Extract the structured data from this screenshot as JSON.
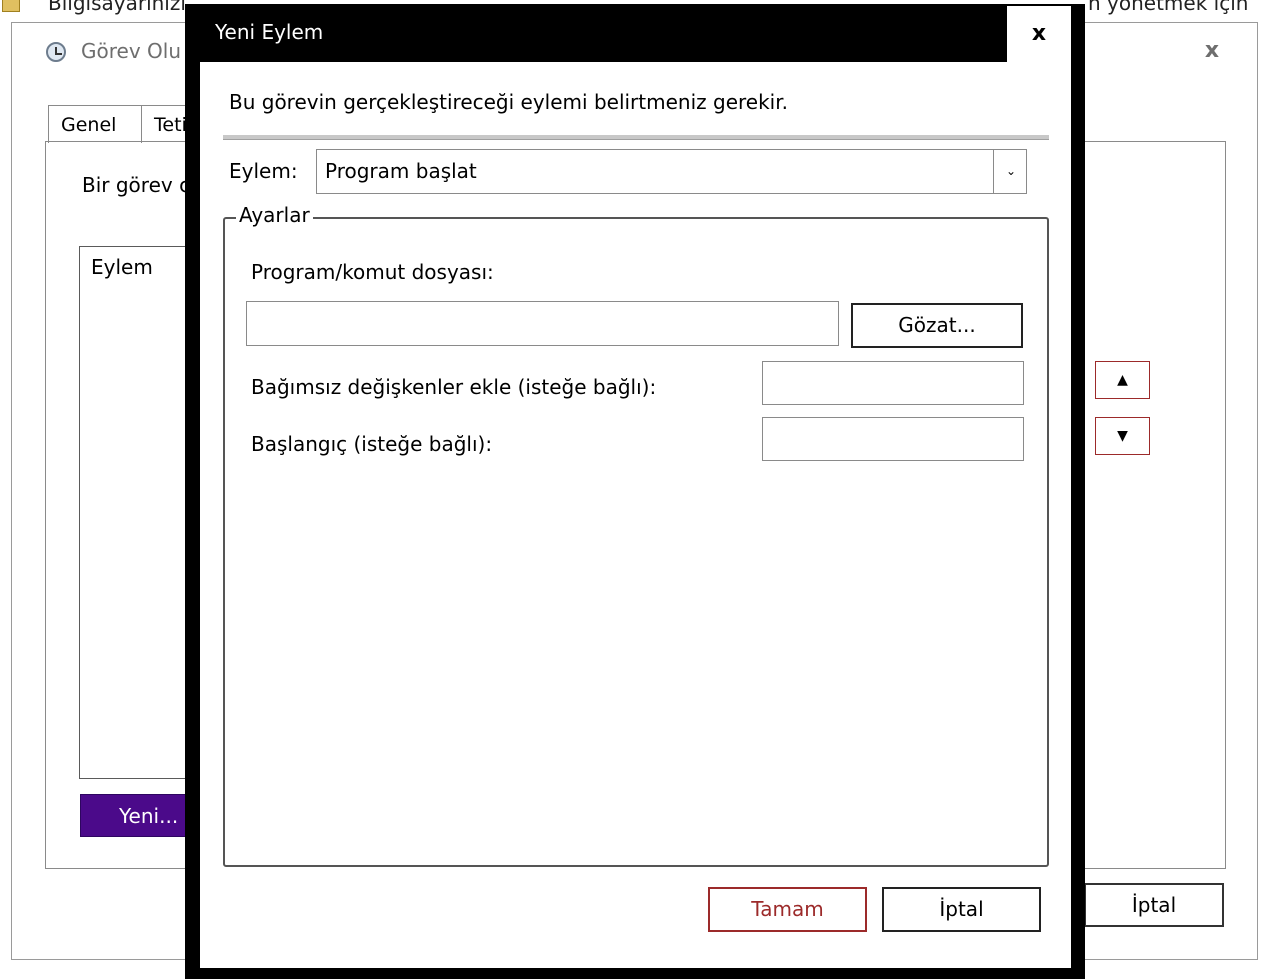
{
  "background": {
    "top_left_text": "Bilgisayarınızı",
    "top_right_text": "n yönetmek için"
  },
  "parent_window": {
    "title": "Görev Olu",
    "close_glyph": "x",
    "tabs": [
      {
        "label": "Genel"
      },
      {
        "label": "Teti"
      }
    ],
    "description": "Bir görev c",
    "list_header": "Eylem",
    "new_button": "Yeni...",
    "move_up_glyph": "▲",
    "move_down_glyph": "▼",
    "cancel_button": "İptal"
  },
  "dialog": {
    "title": "Yeni Eylem",
    "close_glyph": "x",
    "intro": "Bu görevin gerçekleştireceği eylemi belirtmeniz gerekir.",
    "action_label": "Eylem:",
    "action_value": "Program başlat",
    "chevron_glyph": "⌄",
    "settings_legend": "Ayarlar",
    "program_label": "Program/komut dosyası:",
    "program_value": "",
    "browse_button": "Gözat...",
    "args_label": "Bağımsız değişkenler ekle (isteğe bağlı):",
    "args_value": "",
    "start_label": "Başlangıç (isteğe bağlı):",
    "start_value": "",
    "ok_button": "Tamam",
    "cancel_button": "İptal"
  },
  "colors": {
    "accent_purple": "#4b0a8a",
    "accent_red": "#9c2a2a",
    "dialog_frame": "#000000"
  }
}
